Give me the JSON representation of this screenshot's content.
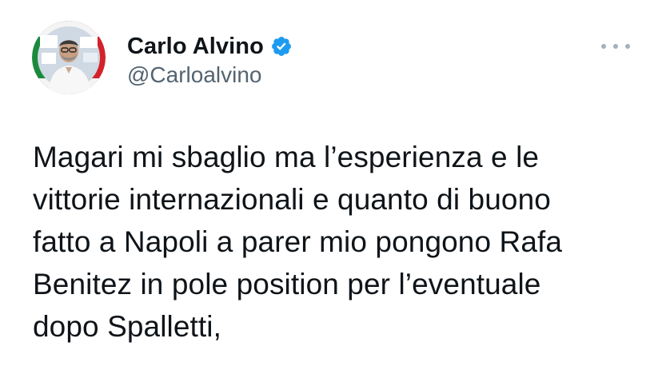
{
  "author": {
    "display_name": "Carlo Alvino",
    "handle": "@Carloalvino",
    "verified": true
  },
  "icons": {
    "verified": "verified-badge-icon",
    "more": "more-options-icon"
  },
  "colors": {
    "text": "#0f1419",
    "secondary_text": "#536471",
    "verified_blue": "#1d9bf0",
    "avatar_ring_green": "#1b8a3c",
    "avatar_ring_red": "#d2232a"
  },
  "tweet": {
    "lines": [
      "Magari mi sbaglio ma l’esperienza e le",
      "vittorie internazionali e quanto di buono",
      "fatto a Napoli a parer mio pongono Rafa",
      "Benitez in pole position per l’eventuale",
      "dopo Spalletti,"
    ]
  }
}
